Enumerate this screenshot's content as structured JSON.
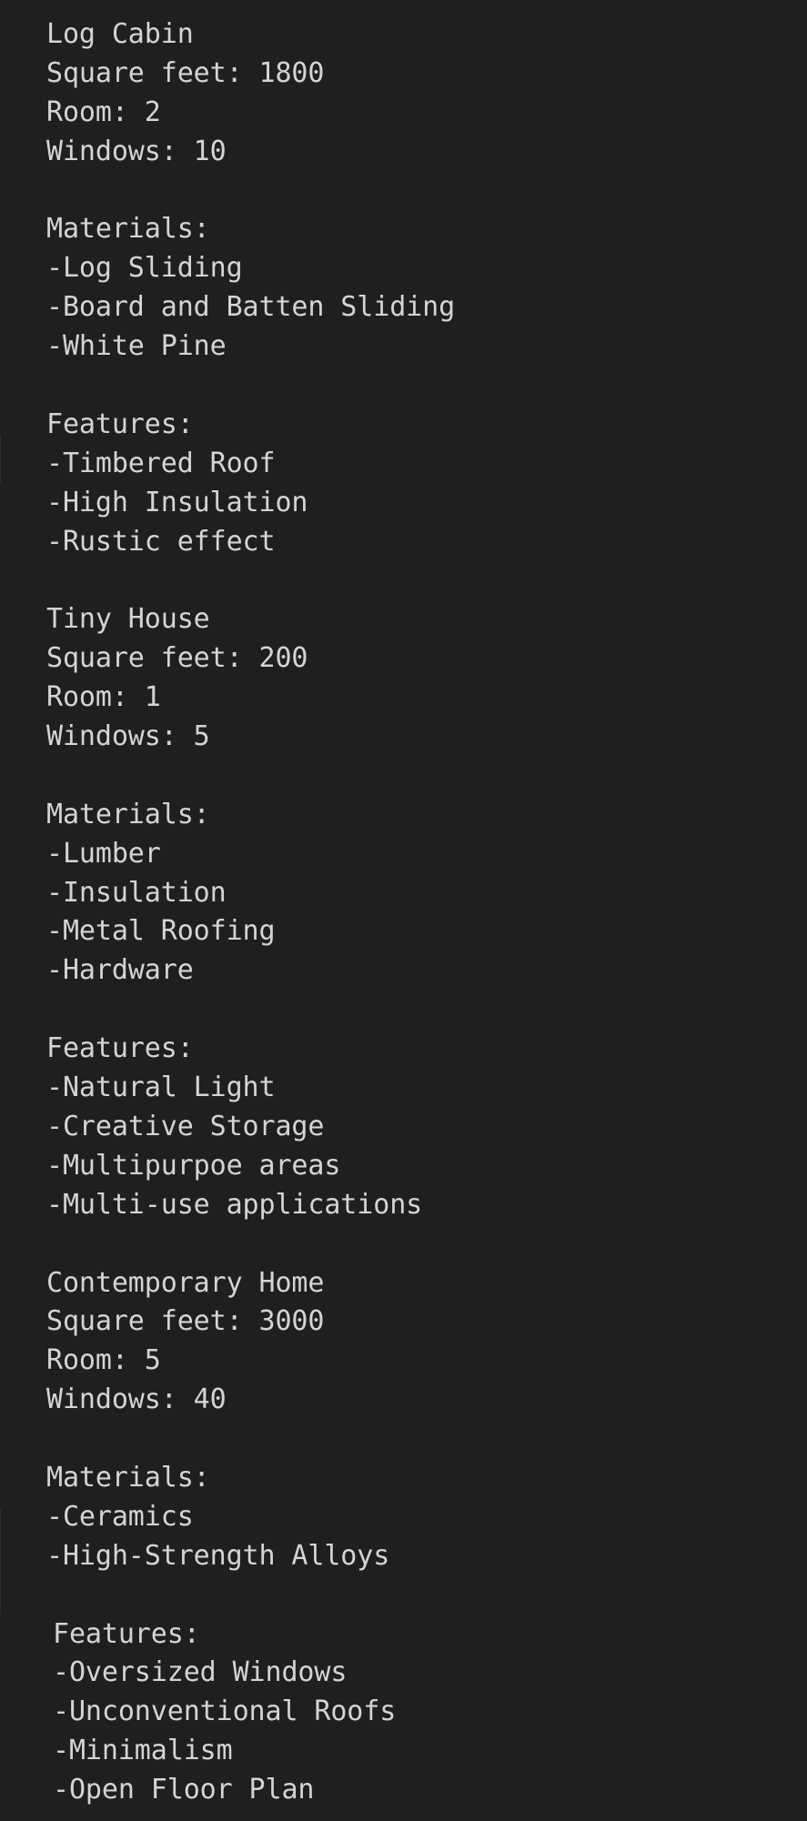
{
  "document": {
    "lines": [
      "Log Cabin",
      "Square feet: 1800",
      "Room: 2",
      "Windows: 10",
      "",
      "Materials:",
      "-Log Sliding",
      "-Board and Batten Sliding",
      "-White Pine",
      "",
      "Features:",
      "-Timbered Roof",
      "-High Insulation",
      "-Rustic effect",
      "",
      "Tiny House",
      "Square feet: 200",
      "Room: 1",
      "Windows: 5",
      "",
      "Materials:",
      "-Lumber",
      "-Insulation",
      "-Metal Roofing",
      "-Hardware",
      "",
      "Features:",
      "-Natural Light",
      "-Creative Storage",
      "-Multipurpoe areas",
      "-Multi-use applications",
      "",
      "Contemporary Home",
      "Square feet: 3000",
      "Room: 5",
      "Windows: 40",
      "",
      "Materials:",
      "-Ceramics",
      "-High-Strength Alloys",
      "",
      "Features:",
      "-Oversized Windows",
      "-Unconventional Roofs",
      "-Minimalism",
      "-Open Floor Plan"
    ]
  }
}
